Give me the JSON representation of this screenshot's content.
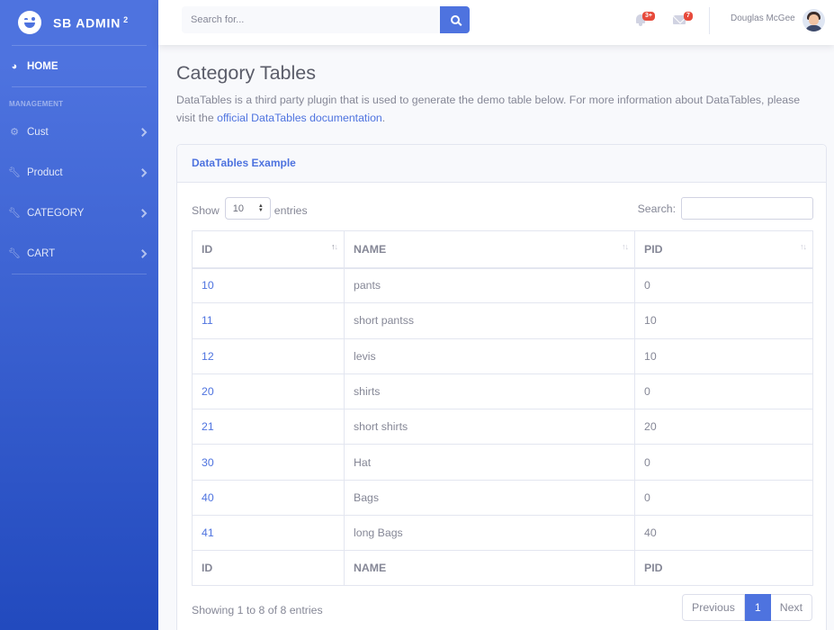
{
  "sidebar": {
    "brand": "SB ADMIN",
    "brand_sup": "2",
    "home_label": "HOME",
    "heading": "MANAGEMENT",
    "items": [
      {
        "label": "Cust"
      },
      {
        "label": "Product"
      },
      {
        "label": "CATEGORY"
      },
      {
        "label": "CART"
      }
    ]
  },
  "topbar": {
    "search_placeholder": "Search for...",
    "alerts_badge": "3+",
    "messages_badge": "7",
    "user_name": "Douglas McGee"
  },
  "page": {
    "title": "Category Tables",
    "intro_text": "DataTables is a third party plugin that is used to generate the demo table below. For more information about DataTables, please visit the ",
    "intro_link": "official DataTables documentation",
    "intro_end": "."
  },
  "card": {
    "header": "DataTables Example",
    "show_label": "Show",
    "length_value": "10",
    "entries_label": "entries",
    "search_label": "Search:",
    "columns": [
      "ID",
      "NAME",
      "PID"
    ],
    "rows": [
      [
        "10",
        "pants",
        "0"
      ],
      [
        "11",
        "short pantss",
        "10"
      ],
      [
        "12",
        "levis",
        "10"
      ],
      [
        "20",
        "shirts",
        "0"
      ],
      [
        "21",
        "short shirts",
        "20"
      ],
      [
        "30",
        "Hat",
        "0"
      ],
      [
        "40",
        "Bags",
        "0"
      ],
      [
        "41",
        "long Bags",
        "40"
      ]
    ],
    "info": "Showing 1 to 8 of 8 entries",
    "pagination": {
      "previous": "Previous",
      "current": "1",
      "next": "Next"
    }
  }
}
